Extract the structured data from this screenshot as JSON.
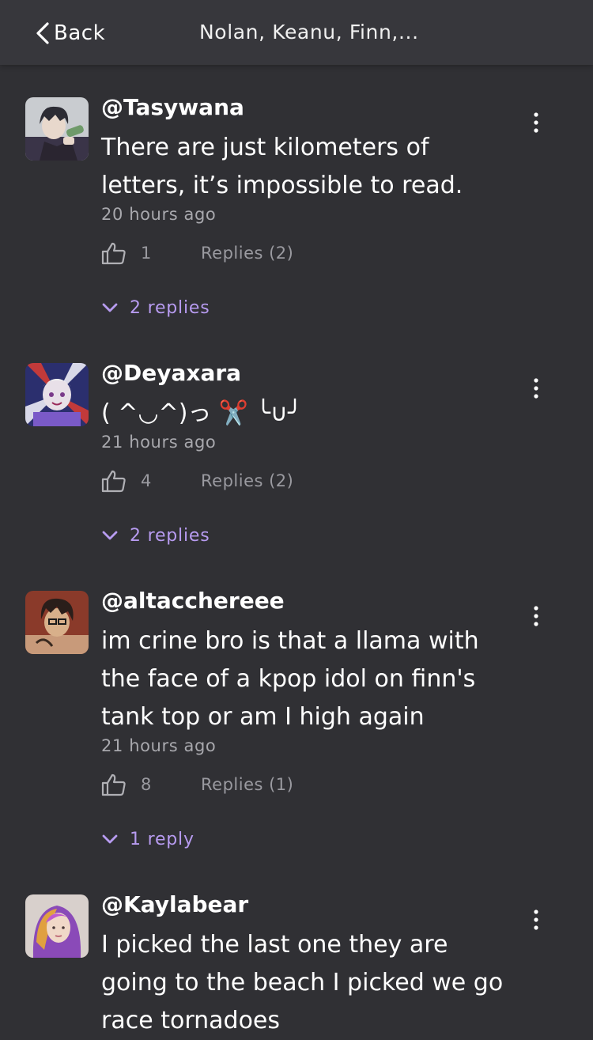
{
  "header": {
    "back_label": "Back",
    "title": "Nolan, Keanu, Finn,..."
  },
  "colors": {
    "background": "#303034",
    "header": "#37373c",
    "accent": "#b79bf0",
    "muted_text": "#a8a8ad"
  },
  "comments": [
    {
      "username": "@Tasywana",
      "text": "There are just kilometers of letters, it’s impossible to read.",
      "time": "20 hours ago",
      "likes": "1",
      "replies_label": "Replies (2)",
      "expand_label": "2 replies"
    },
    {
      "username": "@Deyaxara",
      "text": "( ^◡^)っ ✂️ ╰∪╯",
      "time": "21 hours ago",
      "likes": "4",
      "replies_label": "Replies (2)",
      "expand_label": "2 replies"
    },
    {
      "username": "@altacchereee",
      "text": "im crine bro is that a llama with the face of a kpop idol on finn's tank top or am I high again",
      "time": "21 hours ago",
      "likes": "8",
      "replies_label": "Replies (1)",
      "expand_label": "1 reply"
    },
    {
      "username": "@Kaylabear",
      "text": "I picked the last one they are going to the beach I picked we go race tornadoes"
    }
  ]
}
